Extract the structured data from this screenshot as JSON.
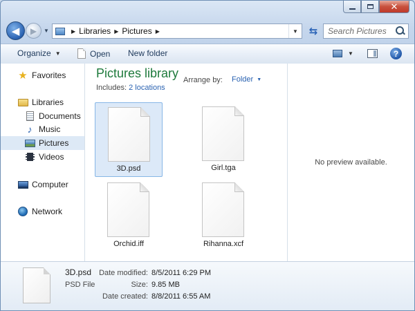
{
  "window": {
    "minimize_glyph": "",
    "maximize_glyph": "",
    "close_glyph": "✕"
  },
  "nav": {
    "back_glyph": "◀",
    "forward_glyph": "▶",
    "breadcrumbs": [
      "Libraries",
      "Pictures"
    ],
    "search_placeholder": "Search Pictures"
  },
  "toolbar": {
    "organize_label": "Organize",
    "open_label": "Open",
    "new_folder_label": "New folder",
    "help_glyph": "?"
  },
  "sidebar": {
    "favorites": "Favorites",
    "libraries": "Libraries",
    "documents": "Documents",
    "music": "Music",
    "pictures": "Pictures",
    "videos": "Videos",
    "computer": "Computer",
    "network": "Network"
  },
  "library": {
    "title": "Pictures library",
    "includes_label": "Includes:",
    "includes_link": "2 locations",
    "arrange_label": "Arrange by:",
    "arrange_value": "Folder"
  },
  "files": [
    {
      "name": "3D.psd",
      "selected": true
    },
    {
      "name": "Girl.tga",
      "selected": false
    },
    {
      "name": "Orchid.iff",
      "selected": false
    },
    {
      "name": "Rihanna.xcf",
      "selected": false
    }
  ],
  "preview": {
    "message": "No preview available."
  },
  "details": {
    "name": "3D.psd",
    "type": "PSD File",
    "date_modified_label": "Date modified:",
    "date_modified": "8/5/2011 6:29 PM",
    "size_label": "Size:",
    "size": "9.85 MB",
    "date_created_label": "Date created:",
    "date_created": "8/8/2011 6:55 AM"
  }
}
